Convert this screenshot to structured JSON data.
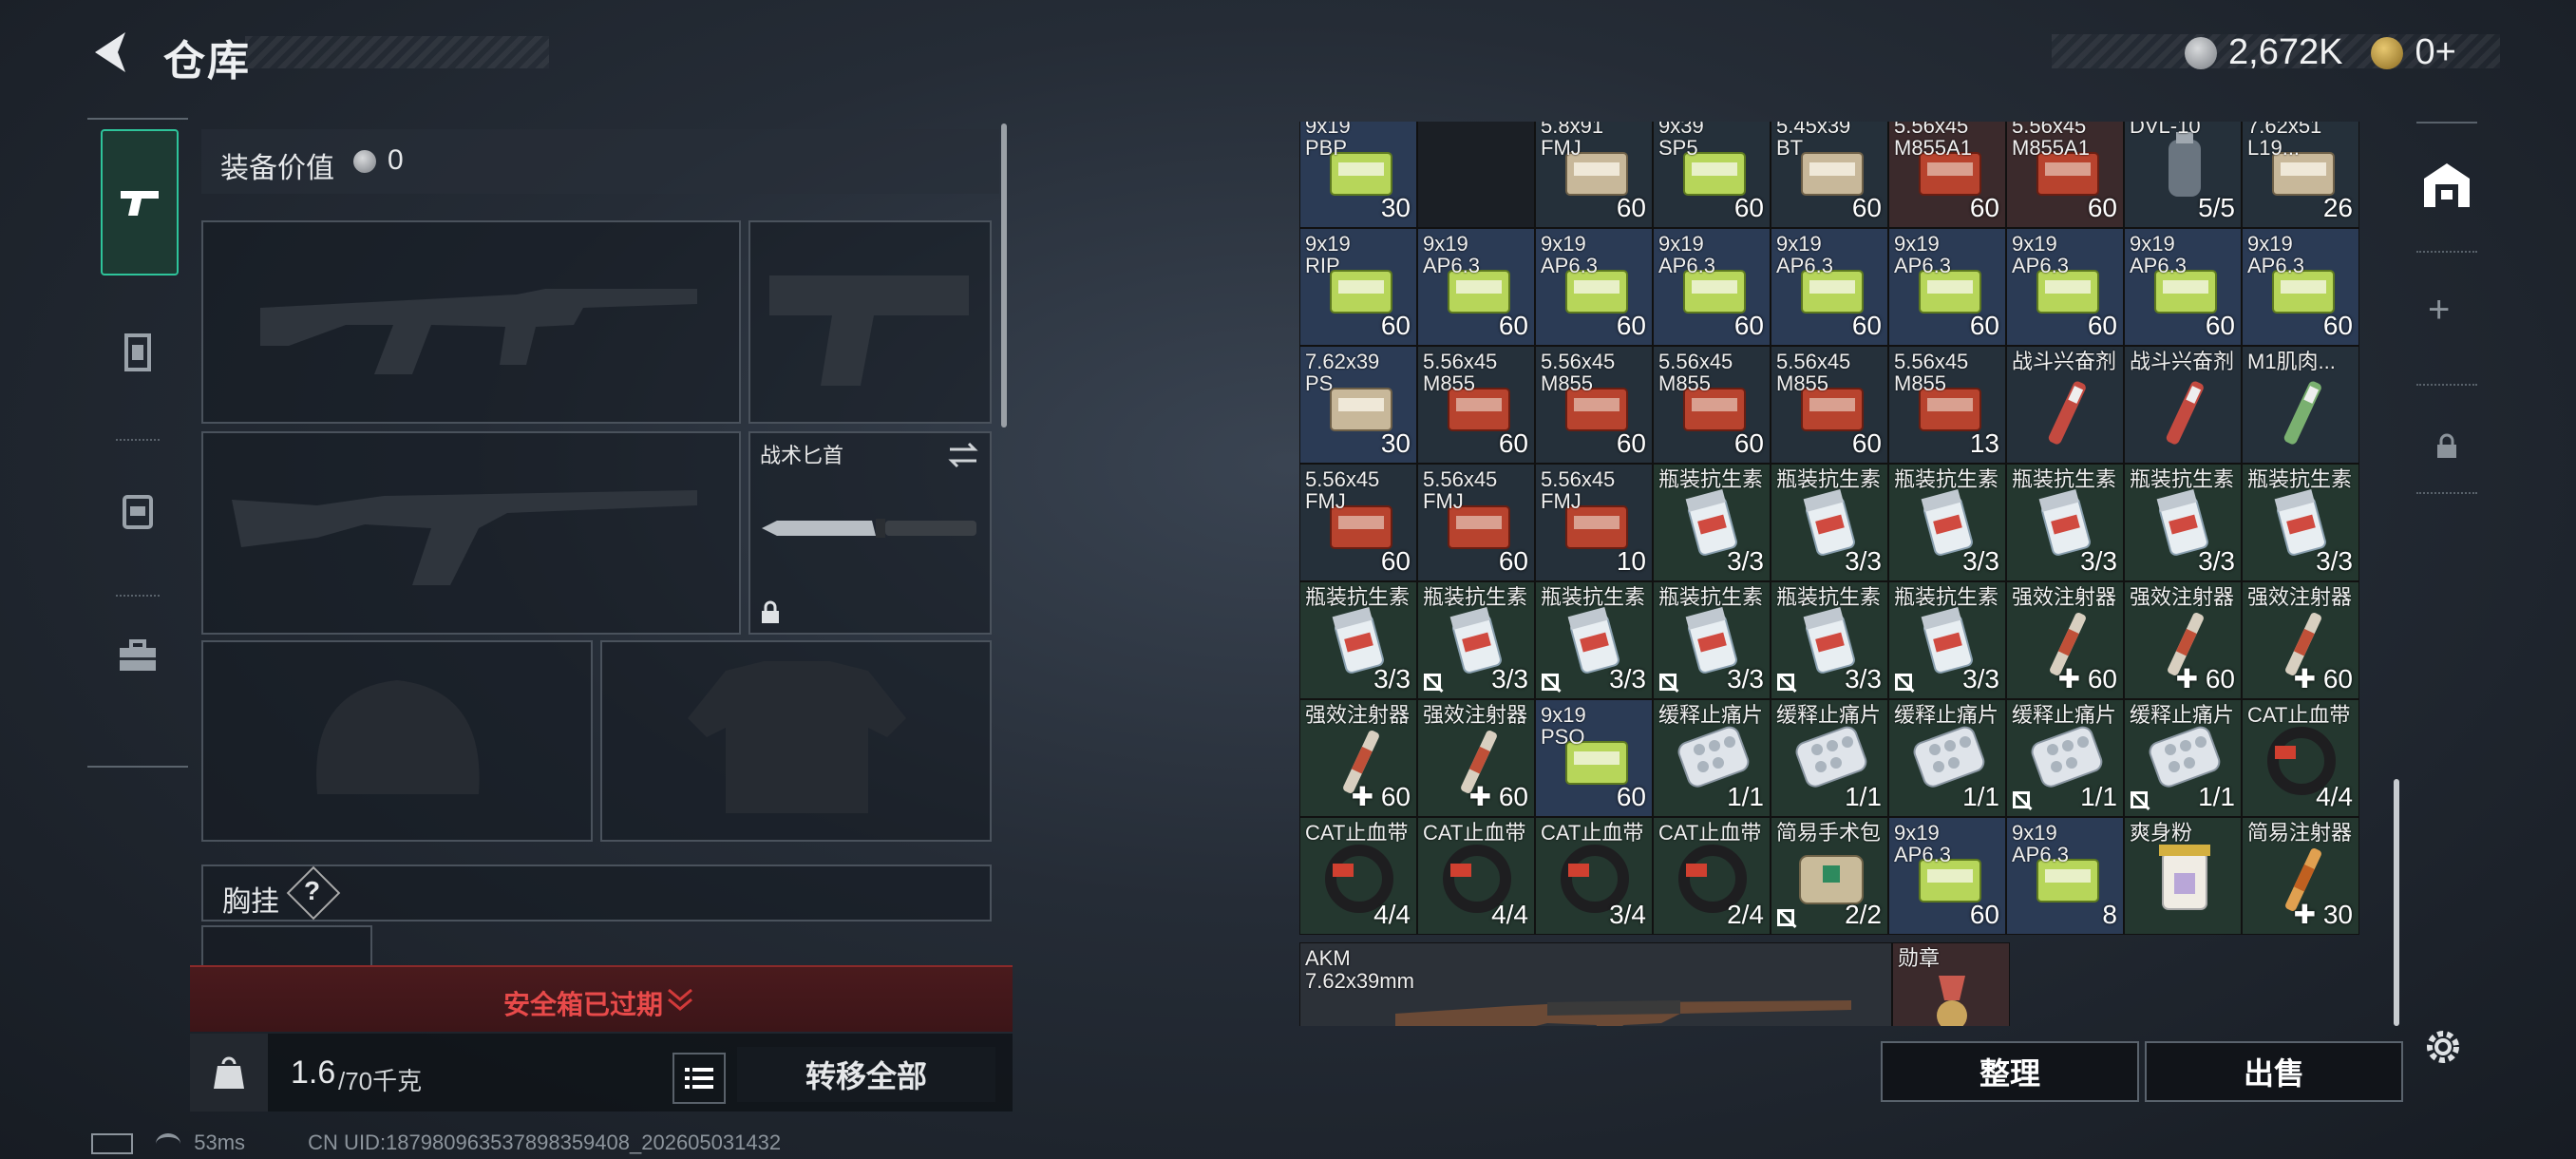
{
  "header": {
    "title": "仓库",
    "currency": "2,672K",
    "tokens": "0+"
  },
  "sidebar": {
    "items": [
      "pistol-icon",
      "armor-icon",
      "backpack-icon",
      "toolbox-icon"
    ]
  },
  "equipment": {
    "value_label": "装备价值",
    "value": "0",
    "melee_label": "战术匕首",
    "chest_rig_label": "胸挂",
    "chest_rig_help": "?",
    "secure_box_status": "安全箱已过期",
    "weight": "1.6",
    "weight_max": "/70千克",
    "transfer_all_label": "转移全部"
  },
  "inventory": {
    "rows": [
      [
        {
          "name": "9x19\nPBP",
          "qty": "30",
          "bg": "blue",
          "type": "ammo-green"
        },
        {
          "name": "",
          "qty": "",
          "bg": "none",
          "type": "empty"
        },
        {
          "name": "5.8x91\nFMJ",
          "qty": "60",
          "bg": "dark",
          "type": "ammo-tan"
        },
        {
          "name": "9x39\nSP5",
          "qty": "60",
          "bg": "dark",
          "type": "ammo-green"
        },
        {
          "name": "5.45x39\nBT",
          "qty": "60",
          "bg": "dark",
          "type": "ammo-tan"
        },
        {
          "name": "5.56x45\nM855A1",
          "qty": "60",
          "bg": "red",
          "type": "ammo-red"
        },
        {
          "name": "5.56x45\nM855A1",
          "qty": "60",
          "bg": "red",
          "type": "ammo-red"
        },
        {
          "name": "DVL-10\n",
          "qty": "5/5",
          "bg": "dark",
          "type": "grenade"
        },
        {
          "name": "7.62x51\nL19...",
          "qty": "26",
          "bg": "dark",
          "type": "ammo-tan"
        }
      ],
      [
        {
          "name": "9x19\nRIP",
          "qty": "60",
          "bg": "blue",
          "type": "ammo-green"
        },
        {
          "name": "9x19\nAP6.3",
          "qty": "60",
          "bg": "blue",
          "type": "ammo-green"
        },
        {
          "name": "9x19\nAP6.3",
          "qty": "60",
          "bg": "blue",
          "type": "ammo-green"
        },
        {
          "name": "9x19\nAP6.3",
          "qty": "60",
          "bg": "blue",
          "type": "ammo-green"
        },
        {
          "name": "9x19\nAP6.3",
          "qty": "60",
          "bg": "blue",
          "type": "ammo-green"
        },
        {
          "name": "9x19\nAP6.3",
          "qty": "60",
          "bg": "blue",
          "type": "ammo-green"
        },
        {
          "name": "9x19\nAP6.3",
          "qty": "60",
          "bg": "blue",
          "type": "ammo-green"
        },
        {
          "name": "9x19\nAP6.3",
          "qty": "60",
          "bg": "blue",
          "type": "ammo-green"
        },
        {
          "name": "9x19\nAP6.3",
          "qty": "60",
          "bg": "blue",
          "type": "ammo-green"
        }
      ],
      [
        {
          "name": "7.62x39\nPS",
          "qty": "30",
          "bg": "blue",
          "type": "ammo-tan"
        },
        {
          "name": "5.56x45\nM855",
          "qty": "60",
          "bg": "dark",
          "type": "ammo-red"
        },
        {
          "name": "5.56x45\nM855",
          "qty": "60",
          "bg": "dark",
          "type": "ammo-red"
        },
        {
          "name": "5.56x45\nM855",
          "qty": "60",
          "bg": "dark",
          "type": "ammo-red"
        },
        {
          "name": "5.56x45\nM855",
          "qty": "60",
          "bg": "dark",
          "type": "ammo-red"
        },
        {
          "name": "5.56x45\nM855",
          "qty": "13",
          "bg": "dark",
          "type": "ammo-red"
        },
        {
          "name": "战斗兴奋剂",
          "qty": "",
          "bg": "dark",
          "type": "injector-red"
        },
        {
          "name": "战斗兴奋剂",
          "qty": "",
          "bg": "dark",
          "type": "injector-red"
        },
        {
          "name": "M1肌肉...",
          "qty": "",
          "bg": "dark",
          "type": "injector-green"
        }
      ],
      [
        {
          "name": "5.56x45\nFMJ",
          "qty": "60",
          "bg": "dark",
          "type": "ammo-red"
        },
        {
          "name": "5.56x45\nFMJ",
          "qty": "60",
          "bg": "dark",
          "type": "ammo-red"
        },
        {
          "name": "5.56x45\nFMJ",
          "qty": "10",
          "bg": "dark",
          "type": "ammo-red"
        },
        {
          "name": "瓶装抗生素",
          "qty": "3/3",
          "bg": "green",
          "type": "pill-bottle"
        },
        {
          "name": "瓶装抗生素",
          "qty": "3/3",
          "bg": "green",
          "type": "pill-bottle"
        },
        {
          "name": "瓶装抗生素",
          "qty": "3/3",
          "bg": "green",
          "type": "pill-bottle"
        },
        {
          "name": "瓶装抗生素",
          "qty": "3/3",
          "bg": "green",
          "type": "pill-bottle"
        },
        {
          "name": "瓶装抗生素",
          "qty": "3/3",
          "bg": "green",
          "type": "pill-bottle"
        },
        {
          "name": "瓶装抗生素",
          "qty": "3/3",
          "bg": "green",
          "type": "pill-bottle"
        }
      ],
      [
        {
          "name": "瓶装抗生素",
          "qty": "3/3",
          "bg": "green",
          "type": "pill-bottle"
        },
        {
          "name": "瓶装抗生素",
          "qty": "3/3",
          "bg": "green",
          "type": "pill-bottle",
          "flag": "nocheck"
        },
        {
          "name": "瓶装抗生素",
          "qty": "3/3",
          "bg": "green",
          "type": "pill-bottle",
          "flag": "nocheck"
        },
        {
          "name": "瓶装抗生素",
          "qty": "3/3",
          "bg": "green",
          "type": "pill-bottle",
          "flag": "nocheck"
        },
        {
          "name": "瓶装抗生素",
          "qty": "3/3",
          "bg": "green",
          "type": "pill-bottle",
          "flag": "nocheck"
        },
        {
          "name": "瓶装抗生素",
          "qty": "3/3",
          "bg": "green",
          "type": "pill-bottle",
          "flag": "nocheck"
        },
        {
          "name": "强效注射器",
          "qty": "60",
          "bg": "green",
          "type": "syringe",
          "flag": "plus"
        },
        {
          "name": "强效注射器",
          "qty": "60",
          "bg": "green",
          "type": "syringe",
          "flag": "plus"
        },
        {
          "name": "强效注射器",
          "qty": "60",
          "bg": "green",
          "type": "syringe",
          "flag": "plus"
        }
      ],
      [
        {
          "name": "强效注射器",
          "qty": "60",
          "bg": "green",
          "type": "syringe",
          "flag": "plus"
        },
        {
          "name": "强效注射器",
          "qty": "60",
          "bg": "green",
          "type": "syringe",
          "flag": "plus"
        },
        {
          "name": "9x19\nPSO",
          "qty": "60",
          "bg": "blue",
          "type": "ammo-green"
        },
        {
          "name": "缓释止痛片",
          "qty": "1/1",
          "bg": "green",
          "type": "blister"
        },
        {
          "name": "缓释止痛片",
          "qty": "1/1",
          "bg": "green",
          "type": "blister"
        },
        {
          "name": "缓释止痛片",
          "qty": "1/1",
          "bg": "green",
          "type": "blister"
        },
        {
          "name": "缓释止痛片",
          "qty": "1/1",
          "bg": "green",
          "type": "blister",
          "flag": "nocheck"
        },
        {
          "name": "缓释止痛片",
          "qty": "1/1",
          "bg": "green",
          "type": "blister",
          "flag": "nocheck"
        },
        {
          "name": "CAT止血带",
          "qty": "4/4",
          "bg": "green",
          "type": "tourniquet"
        }
      ],
      [
        {
          "name": "CAT止血带",
          "qty": "4/4",
          "bg": "green",
          "type": "tourniquet"
        },
        {
          "name": "CAT止血带",
          "qty": "4/4",
          "bg": "green",
          "type": "tourniquet"
        },
        {
          "name": "CAT止血带",
          "qty": "3/4",
          "bg": "green",
          "type": "tourniquet"
        },
        {
          "name": "CAT止血带",
          "qty": "2/4",
          "bg": "green",
          "type": "tourniquet"
        },
        {
          "name": "简易手术包",
          "qty": "2/2",
          "bg": "green",
          "type": "surgery-kit",
          "flag": "nocheck"
        },
        {
          "name": "9x19\nAP6.3",
          "qty": "60",
          "bg": "blue",
          "type": "ammo-green"
        },
        {
          "name": "9x19\nAP6.3",
          "qty": "8",
          "bg": "blue",
          "type": "ammo-green"
        },
        {
          "name": "爽身粉",
          "qty": "",
          "bg": "green",
          "type": "powder"
        },
        {
          "name": "简易注射器",
          "qty": "30",
          "bg": "green",
          "type": "syringe-orange",
          "flag": "plus"
        }
      ]
    ],
    "weapon": {
      "name": "AKM",
      "caliber": "7.62x39mm"
    },
    "medal_label": "勋章",
    "sort_label": "整理",
    "sell_label": "出售"
  },
  "status": {
    "ping": "53ms",
    "uid": "CN UID:18798096353789835940​8_202605031432"
  }
}
